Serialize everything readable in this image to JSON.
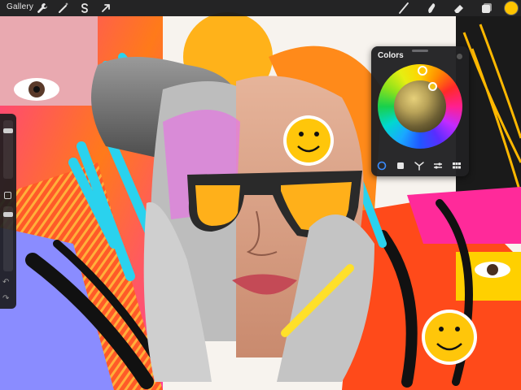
{
  "toolbar": {
    "gallery_label": "Gallery",
    "left_tools": [
      "wrench-icon",
      "magic-wand-icon",
      "selection-s-icon",
      "transform-arrow-icon"
    ],
    "right_tools": [
      "brush-icon",
      "smudge-icon",
      "eraser-icon",
      "layers-icon"
    ],
    "current_color": "#ffc400"
  },
  "sidebar": {
    "brush_size_level": 0.15,
    "opacity_level": 0.1,
    "items": [
      "brush-size-slider",
      "modify-button",
      "opacity-slider",
      "undo-icon",
      "redo-icon"
    ],
    "undo_glyph": "↶",
    "redo_glyph": "↷"
  },
  "colors_panel": {
    "title": "Colors",
    "selected_color": "#f2c218",
    "tabs": [
      "disc-tab",
      "classic-tab",
      "harmony-tab",
      "value-tab",
      "palettes-tab"
    ],
    "active_tab": 0,
    "accent": "#3a8cff"
  },
  "canvas": {
    "artwork": "collage portrait with sunglasses and smiley stickers"
  }
}
